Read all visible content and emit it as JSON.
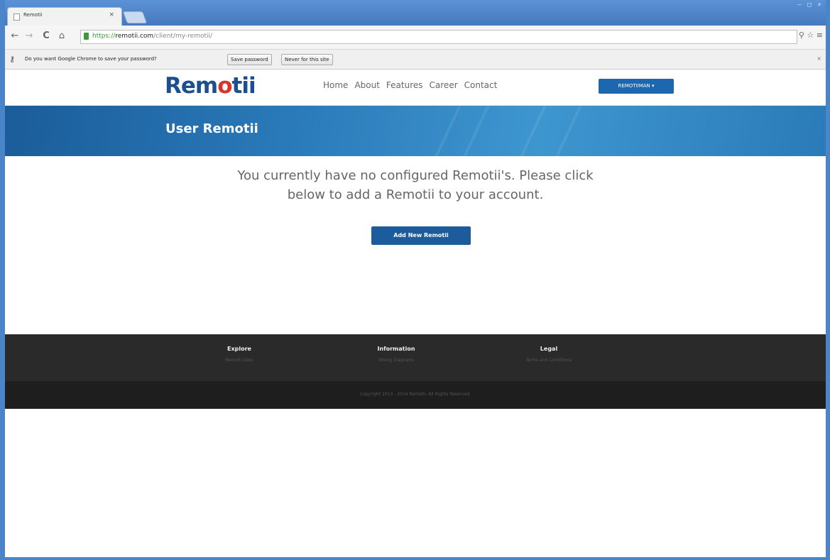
{
  "browser": {
    "tab_title": "Remotii",
    "tab_close": "×",
    "window_controls": [
      "–",
      "□",
      "×"
    ],
    "nav": {
      "back": "←",
      "forward": "→",
      "reload": "C",
      "home": "⌂"
    },
    "url": {
      "scheme": "https://",
      "host": "remotii.com",
      "path": "/client/my-remotii/"
    },
    "toolbar_right": "⚲ ☆ ≡"
  },
  "infobar": {
    "message": "Do you want Google Chrome to save your password?",
    "save_label": "Save password",
    "never_label": "Never for this site",
    "close": "×"
  },
  "site": {
    "logo_start": "Rem",
    "logo_power": "o",
    "logo_end": "tii",
    "nav": [
      "Home",
      "About",
      "Features",
      "Career",
      "Contact"
    ],
    "user_menu": "REMOTIIMAN ▾",
    "banner_title": "User Remotii",
    "message_line1": "You currently have no configured Remotii's. Please click",
    "message_line2": "below to add a Remotii to your account.",
    "add_button": "Add New Remotii"
  },
  "footer": {
    "columns": [
      {
        "heading": "Explore",
        "link": "Remotii Uses"
      },
      {
        "heading": "Information",
        "link": "Wiring Diagrams"
      },
      {
        "heading": "Legal",
        "link": "Terms and Conditions"
      }
    ],
    "copyright": "Copyright 2013 - 2014 Remotii. All Rights Reserved."
  },
  "colors": {
    "brand_blue": "#1b4f8f",
    "accent_red": "#d9342b",
    "button_blue": "#1d5c9c",
    "footer_dark": "#2a2a2a"
  }
}
